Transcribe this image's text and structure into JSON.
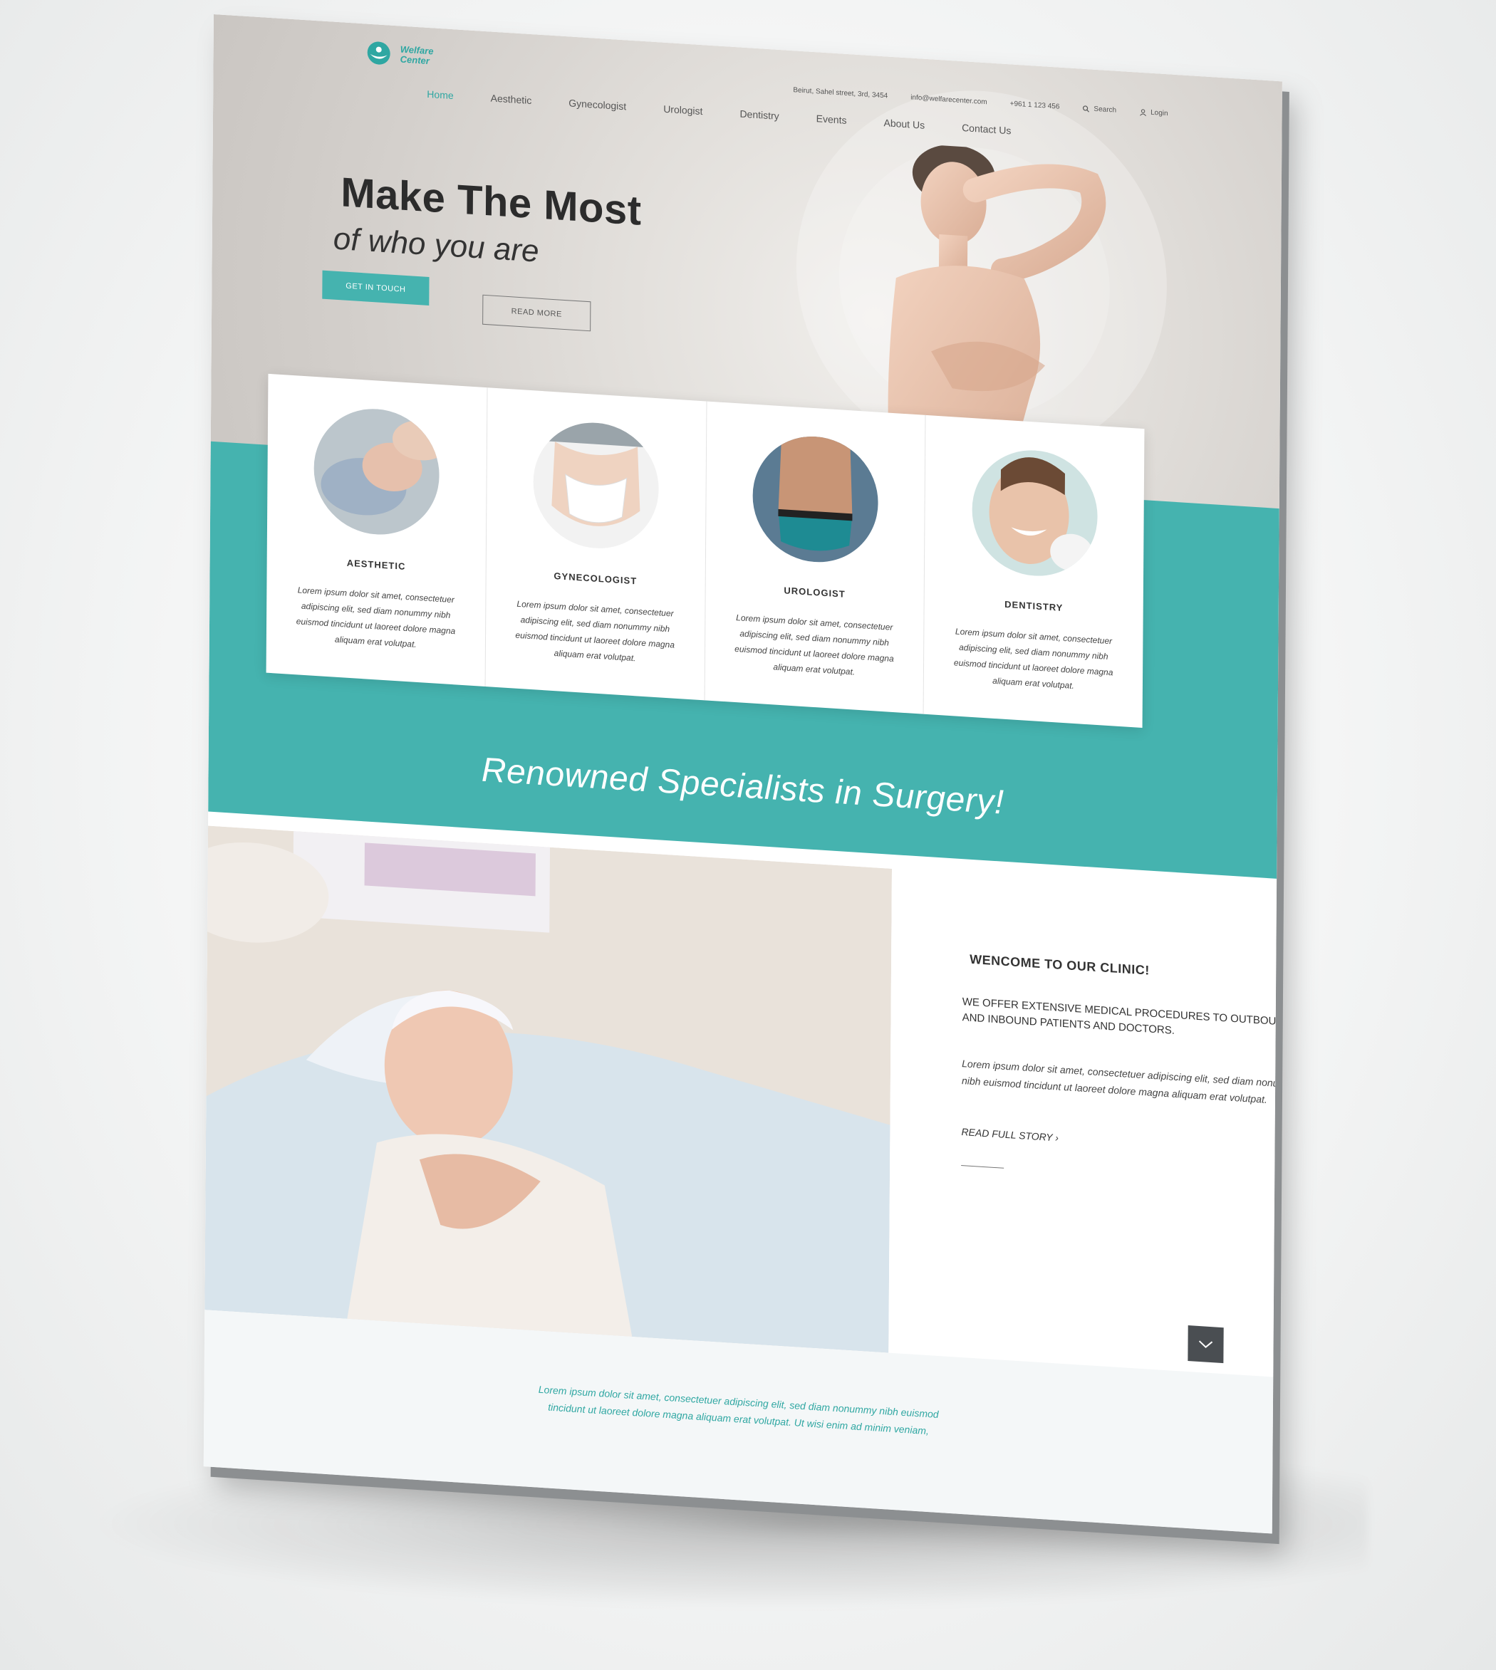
{
  "header": {
    "logo_line1": "Welfare",
    "logo_line2": "Center",
    "address": "Beirut, Sahel street, 3rd, 3454",
    "email": "info@welfarecenter.com",
    "phone": "+961 1 123 456",
    "search_label": "Search",
    "login_label": "Login"
  },
  "nav": {
    "items": [
      {
        "label": "Home"
      },
      {
        "label": "Aesthetic"
      },
      {
        "label": "Gynecologist"
      },
      {
        "label": "Urologist"
      },
      {
        "label": "Dentistry"
      },
      {
        "label": "Events"
      },
      {
        "label": "About Us"
      },
      {
        "label": "Contact Us"
      }
    ]
  },
  "hero": {
    "title": "Make The Most",
    "subtitle": "of who you are",
    "cta_primary": "GET IN TOUCH",
    "cta_secondary": "READ MORE"
  },
  "services": [
    {
      "title": "AESTHETIC",
      "desc": "Lorem ipsum dolor sit amet, consectetuer adipiscing elit, sed diam nonummy nibh euismod tincidunt ut laoreet dolore magna aliquam erat volutpat."
    },
    {
      "title": "GYNECOLOGIST",
      "desc": "Lorem ipsum dolor sit amet, consectetuer adipiscing elit, sed diam nonummy nibh euismod tincidunt ut laoreet dolore magna aliquam erat volutpat."
    },
    {
      "title": "UROLOGIST",
      "desc": "Lorem ipsum dolor sit amet, consectetuer adipiscing elit, sed diam nonummy nibh euismod tincidunt ut laoreet dolore magna aliquam erat volutpat."
    },
    {
      "title": "DENTISTRY",
      "desc": "Lorem ipsum dolor sit amet, consectetuer adipiscing elit, sed diam nonummy nibh euismod tincidunt ut laoreet dolore magna aliquam erat volutpat."
    }
  ],
  "tagline": "Renowned Specialists in Surgery!",
  "welcome": {
    "heading": "WENCOME TO OUR CLINIC!",
    "subheading": "WE OFFER EXTENSIVE MEDICAL PROCEDURES TO OUTBOUND AND INBOUND PATIENTS AND DOCTORS.",
    "body": "Lorem ipsum dolor sit amet, consectetuer adipiscing elit, sed diam nonummy nibh euismod tincidunt ut laoreet dolore magna aliquam erat volutpat.",
    "link": "READ FULL STORY ›"
  },
  "footer": {
    "text": "Lorem ipsum dolor sit amet, consectetuer adipiscing elit, sed diam nonummy nibh euismod tincidunt ut laoreet dolore magna aliquam erat volutpat. Ut wisi enim ad minim veniam,"
  },
  "icons": {
    "search": "search-icon",
    "user": "user-icon",
    "scroll": "chevron-down-icon"
  },
  "colors": {
    "accent": "#45b3af",
    "dark": "#4a4e52"
  }
}
